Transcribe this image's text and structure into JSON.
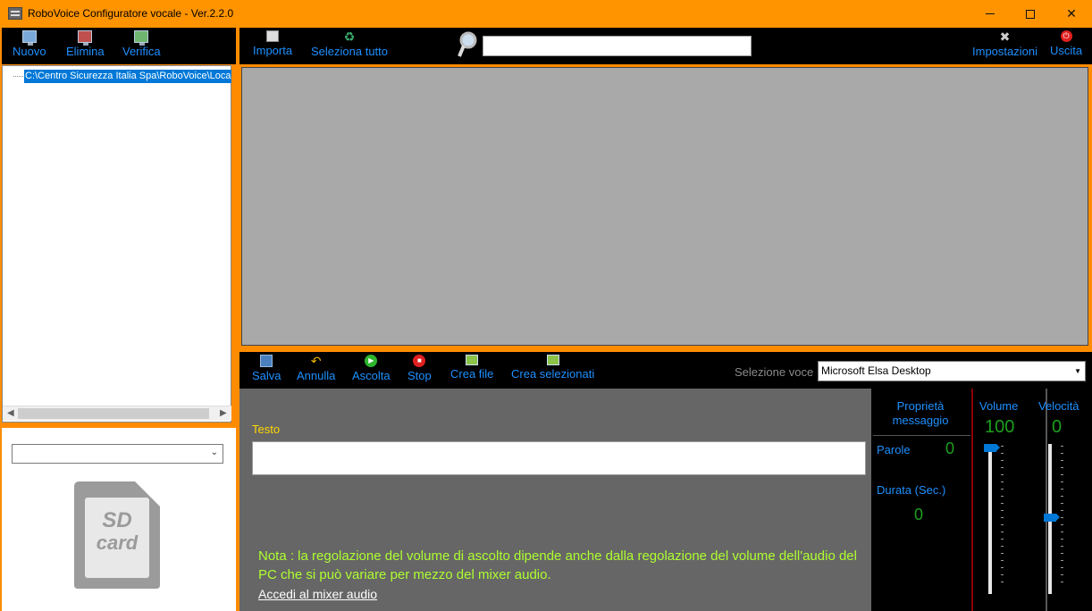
{
  "window": {
    "title": "RoboVoice Configuratore vocale - Ver.2.2.0",
    "controls": {
      "minimize": "—",
      "maximize": "☐",
      "close": "✕"
    }
  },
  "left_toolbar": {
    "items": [
      {
        "label": "Nuovo",
        "icon": "new-monitor-icon"
      },
      {
        "label": "Elimina",
        "icon": "delete-monitor-icon"
      },
      {
        "label": "Verifica",
        "icon": "verify-monitor-icon"
      }
    ]
  },
  "tree": {
    "root_label": "C:\\Centro Sicurezza Italia Spa\\RoboVoice\\Loca"
  },
  "left_lower": {
    "combo_value": "",
    "sd_card_text": [
      "SD",
      "card"
    ]
  },
  "top_toolbar": {
    "import_label": "Importa",
    "select_all_label": "Seleziona tutto",
    "search_value": "",
    "settings_label": "Impostazioni",
    "exit_label": "Uscita"
  },
  "mid_toolbar": {
    "save_label": "Salva",
    "undo_label": "Annulla",
    "listen_label": "Ascolta",
    "stop_label": "Stop",
    "create_file_label": "Crea file",
    "create_selected_label": "Crea selezionati",
    "voice_label": "Selezione voce",
    "voice_value": "Microsoft Elsa Desktop"
  },
  "editor": {
    "text_label": "Testo",
    "text_value": "",
    "note": "Nota : la regolazione del volume di ascolto dipende anche dalla regolazione del volume dell'audio del PC che si può variare per mezzo del mixer audio.",
    "mixer_link": "Accedi al mixer audio"
  },
  "properties": {
    "title": "Proprietà messaggio",
    "words_label": "Parole",
    "words_value": "0",
    "duration_label": "Durata (Sec.)",
    "duration_value": "0",
    "volume_label": "Volume",
    "volume_value": "100",
    "speed_label": "Velocità",
    "speed_value": "0"
  },
  "colors": {
    "titlebar": "#ff9400",
    "toolbar_bg": "#000000",
    "toolbar_text": "#1e90ff",
    "grid_bg": "#a9a9a9",
    "note_text": "#adff2f",
    "value_green": "#1ca01c",
    "label_yellow": "#ffd700"
  }
}
